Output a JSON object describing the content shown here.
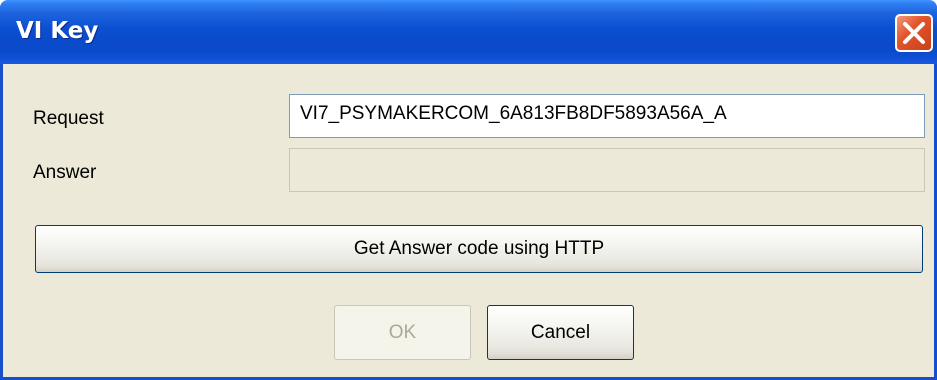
{
  "window": {
    "title": "VI Key"
  },
  "form": {
    "request_label": "Request",
    "request_value": "VI7_PSYMAKERCOM_6A813FB8DF5893A56A_A",
    "answer_label": "Answer",
    "answer_value": ""
  },
  "buttons": {
    "http_label": "Get Answer code using HTTP",
    "ok_label": "OK",
    "cancel_label": "Cancel"
  },
  "colors": {
    "title_bar": "#0B4FD1",
    "dialog_bg": "#ECE9D8",
    "close_button": "#E3552C"
  },
  "icons": {
    "close": "close-icon"
  }
}
